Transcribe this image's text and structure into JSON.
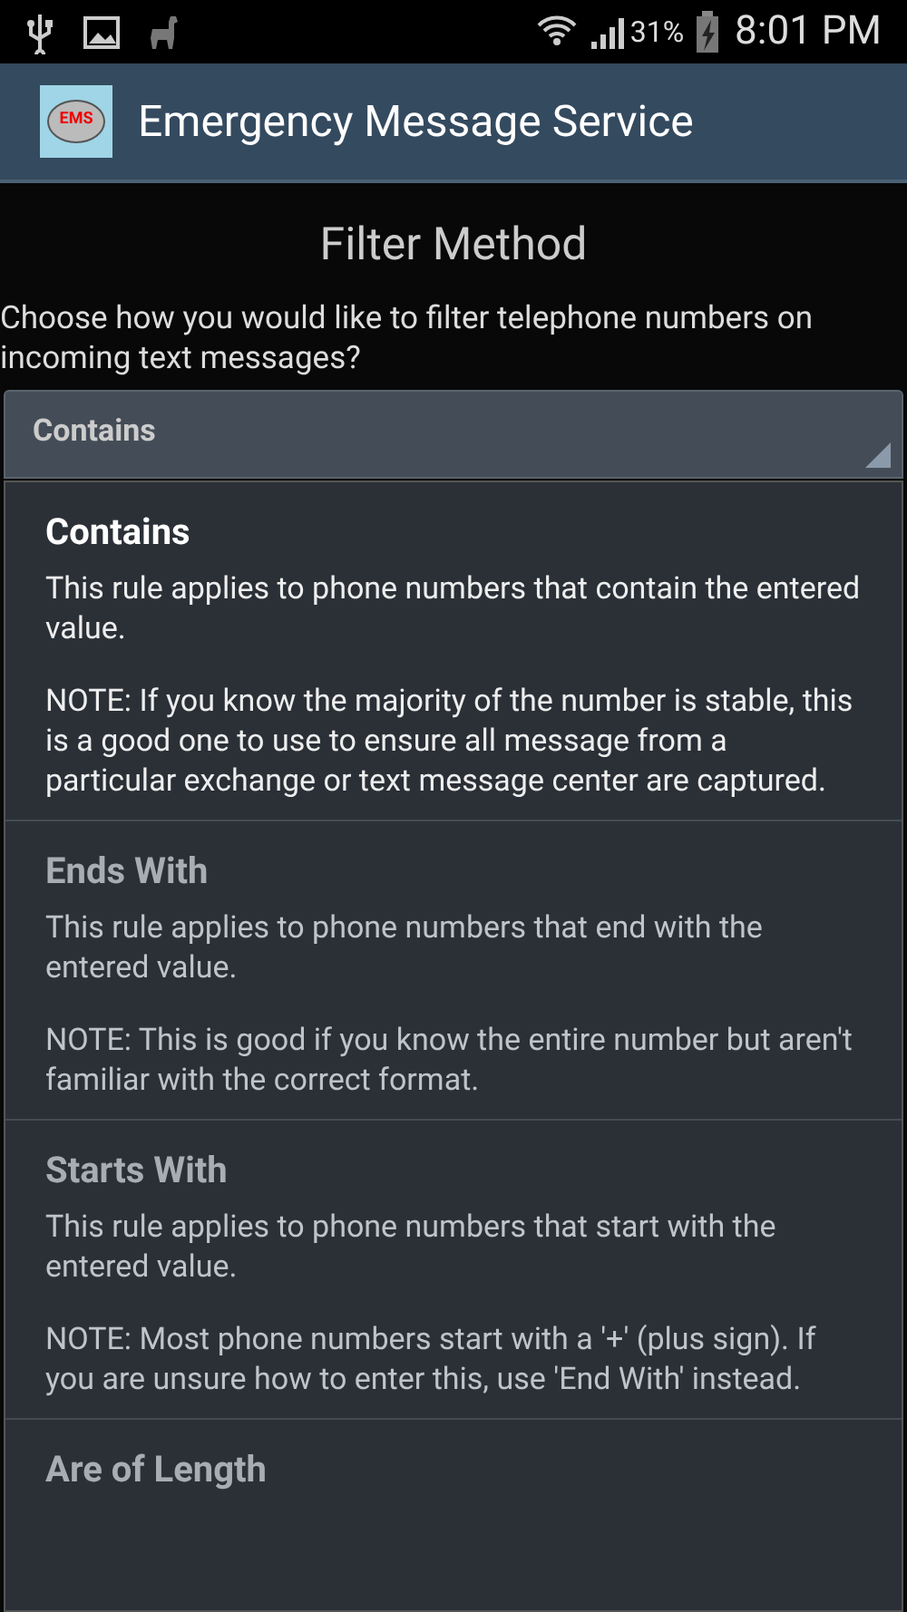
{
  "status_bar": {
    "battery": "31%",
    "time": "8:01 PM"
  },
  "app_bar": {
    "title": "Emergency Message Service",
    "logo_text": "EMS"
  },
  "heading": "Filter Method",
  "prompt": "Choose how you would like to filter telephone numbers on incoming text messages?",
  "spinner": {
    "value": "Contains"
  },
  "options": [
    {
      "title": "Contains",
      "selected": true,
      "description": "This rule applies to phone numbers that contain the entered value.",
      "note": "NOTE: If you know the majority of the number is stable, this is a good one to use to ensure all message from a particular exchange or text message center are captured."
    },
    {
      "title": "Ends With",
      "selected": false,
      "description": "This rule applies to phone numbers that end with the entered value.",
      "note": "NOTE: This is good if you know the entire number but aren't familiar with the correct format."
    },
    {
      "title": "Starts With",
      "selected": false,
      "description": "This rule applies to phone numbers that start with the entered value.",
      "note": "NOTE: Most phone numbers start with a '+' (plus sign). If you are unsure how to enter this, use 'End With' instead."
    },
    {
      "title": "Are of Length",
      "selected": false
    }
  ]
}
